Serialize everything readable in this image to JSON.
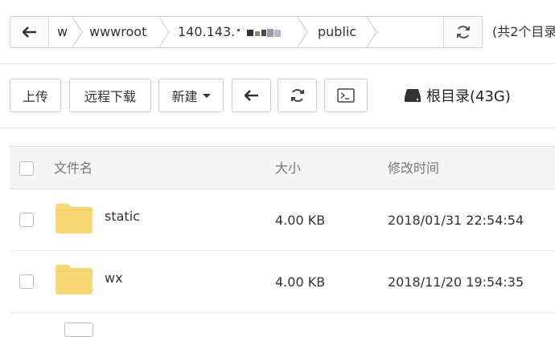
{
  "pathbar": {
    "crumbs": [
      "w",
      "wwwroot",
      "140.143.",
      "public"
    ],
    "total_label": "(共2个目录"
  },
  "toolbar": {
    "upload_label": "上传",
    "remote_download_label": "远程下载",
    "new_label": "新建",
    "disk_label": "根目录(43G)"
  },
  "table": {
    "headers": {
      "name": "文件名",
      "size": "大小",
      "modified": "修改时间"
    },
    "rows": [
      {
        "name": "static",
        "size": "4.00 KB",
        "modified": "2018/01/31 22:54:54"
      },
      {
        "name": "wx",
        "size": "4.00 KB",
        "modified": "2018/11/20 19:54:35"
      }
    ]
  },
  "icons": {
    "back": "arrow-left-icon",
    "refresh": "refresh-icon",
    "terminal": "terminal-icon",
    "disk": "hard-disk-icon",
    "folder": "folder-icon"
  },
  "colors": {
    "folder": "#f8d775",
    "folder_dark": "#f0c95a"
  }
}
